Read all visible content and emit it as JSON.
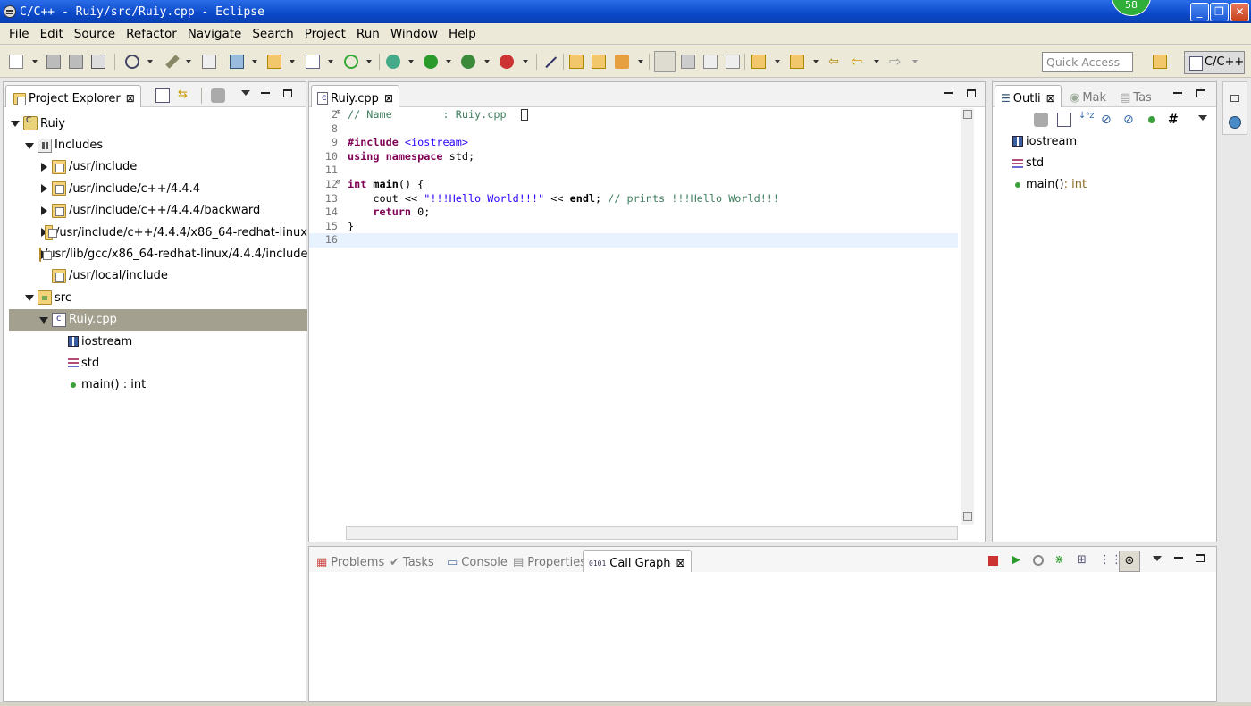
{
  "window": {
    "title": "C/C++ - Ruiy/src/Ruiy.cpp - Eclipse",
    "badge": "58"
  },
  "menu": [
    "File",
    "Edit",
    "Source",
    "Refactor",
    "Navigate",
    "Search",
    "Project",
    "Run",
    "Window",
    "Help"
  ],
  "quick_access": {
    "placeholder": "Quick Access"
  },
  "perspective": "C/C++",
  "project_explorer": {
    "tab": "Project Explorer",
    "tree": [
      {
        "label": "Ruiy"
      },
      {
        "label": "Includes"
      },
      {
        "label": "/usr/include"
      },
      {
        "label": "/usr/include/c++/4.4.4"
      },
      {
        "label": "/usr/include/c++/4.4.4/backward"
      },
      {
        "label": "/usr/include/c++/4.4.4/x86_64-redhat-linux"
      },
      {
        "label": "/usr/lib/gcc/x86_64-redhat-linux/4.4.4/include"
      },
      {
        "label": "/usr/local/include"
      },
      {
        "label": "src"
      },
      {
        "label": "Ruiy.cpp"
      },
      {
        "label": "iostream"
      },
      {
        "label": "std"
      },
      {
        "label": "main() : int"
      }
    ]
  },
  "editor": {
    "tab": "Ruiy.cpp",
    "lines": [
      {
        "n": "2",
        "parts": [
          {
            "t": "// Name        : Ruiy.cpp",
            "c": "cm"
          }
        ]
      },
      {
        "n": "8",
        "parts": []
      },
      {
        "n": "9",
        "parts": [
          {
            "t": "#include ",
            "c": "pp"
          },
          {
            "t": "<iostream>",
            "c": "inc-s"
          }
        ]
      },
      {
        "n": "10",
        "parts": [
          {
            "t": "using namespace",
            "c": "kw"
          },
          {
            "t": " std;",
            "c": ""
          }
        ]
      },
      {
        "n": "11",
        "parts": []
      },
      {
        "n": "12",
        "parts": [
          {
            "t": "int",
            "c": "kw"
          },
          {
            "t": " ",
            "c": ""
          },
          {
            "t": "main",
            "c": "b"
          },
          {
            "t": "() {",
            "c": ""
          }
        ]
      },
      {
        "n": "13",
        "parts": [
          {
            "t": "    cout << ",
            "c": ""
          },
          {
            "t": "\"!!!Hello World!!!\"",
            "c": "str"
          },
          {
            "t": " << ",
            "c": ""
          },
          {
            "t": "endl",
            "c": "b"
          },
          {
            "t": "; ",
            "c": ""
          },
          {
            "t": "// prints !!!Hello World!!!",
            "c": "cm"
          }
        ]
      },
      {
        "n": "14",
        "parts": [
          {
            "t": "    ",
            "c": ""
          },
          {
            "t": "return",
            "c": "kw"
          },
          {
            "t": " 0;",
            "c": ""
          }
        ]
      },
      {
        "n": "15",
        "parts": [
          {
            "t": "}",
            "c": ""
          }
        ]
      },
      {
        "n": "16",
        "parts": []
      }
    ]
  },
  "outline": {
    "tabs": [
      "Outli",
      "Mak",
      "Tas"
    ],
    "items": [
      {
        "label": "iostream"
      },
      {
        "label": "std"
      },
      {
        "label": "main()",
        "type": " : int"
      }
    ]
  },
  "bottom": {
    "tabs": [
      "Problems",
      "Tasks",
      "Console",
      "Properties",
      "Call Graph"
    ]
  }
}
